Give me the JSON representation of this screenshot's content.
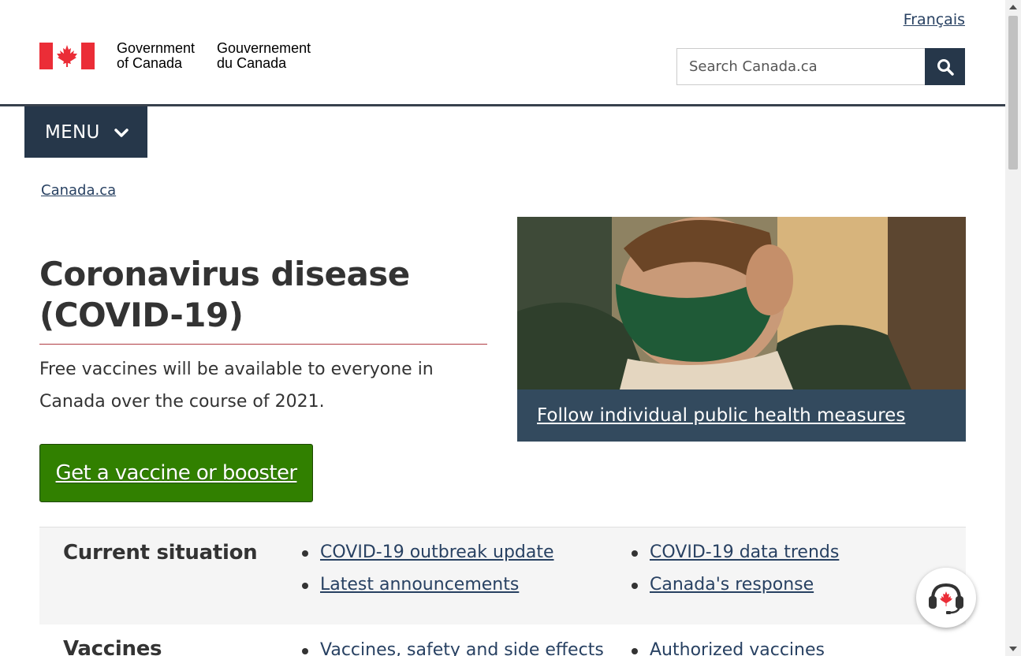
{
  "header": {
    "language_link": "Français",
    "brand_en": "Government\nof Canada",
    "brand_fr": "Gouvernement\ndu Canada",
    "search_placeholder": "Search Canada.ca",
    "search_icon": "search-icon"
  },
  "nav": {
    "menu_label": "MENU",
    "menu_icon": "chevron-down-icon"
  },
  "breadcrumb": [
    "Canada.ca"
  ],
  "main": {
    "title": "Coronavirus disease (COVID-19)",
    "lead": "Free vaccines will be available to everyone in Canada over the course of 2021.",
    "cta_label": "Get a vaccine or booster",
    "feature_caption": "Follow individual public health measures"
  },
  "sections": [
    {
      "heading": "Current situation",
      "links_col1": [
        "COVID-19 outbreak update",
        "Latest announcements"
      ],
      "links_col2": [
        "COVID-19 data trends",
        "Canada's response"
      ]
    },
    {
      "heading": "Vaccines",
      "links_col1": [
        "Vaccines, safety and side effects"
      ],
      "links_col2": [
        "Authorized vaccines"
      ]
    }
  ],
  "chat": {
    "icon": "headset-icon"
  },
  "colors": {
    "nav_bg": "#26374a",
    "cta_green": "#318000",
    "link": "#284162",
    "flag_red": "#eb2d37",
    "title_rule": "#af3c43"
  }
}
